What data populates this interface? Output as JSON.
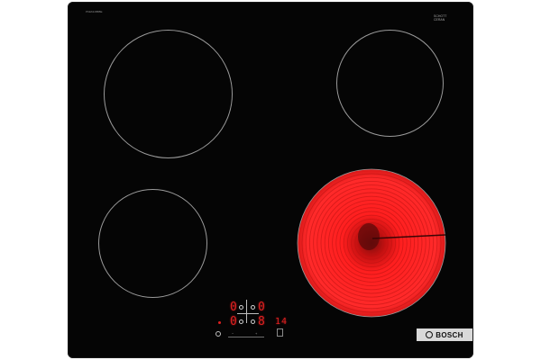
{
  "cooktop": {
    "model_label": "PKE611BB8E",
    "glass_marking_line1": "SCHOTT",
    "glass_marking_line2": "CERAN",
    "glass_marking_line3": "",
    "brand": "BOSCH",
    "colors": {
      "glass": "#050505",
      "zone_outline": "#9a9a9a",
      "hot_zone": "#ff1a1a",
      "display_red": "#e02020",
      "brand_plate": "#d9d9d9"
    }
  },
  "zones": [
    {
      "name": "front-left",
      "state": "off"
    },
    {
      "name": "rear-left",
      "state": "off"
    },
    {
      "name": "rear-right",
      "state": "off"
    },
    {
      "name": "front-right",
      "state": "on"
    }
  ],
  "display": {
    "rear_left_level": "0",
    "rear_right_level": "0",
    "front_left_level": "0",
    "front_right_level": "8",
    "timer_value": "14",
    "minus_label": "−",
    "plus_label": "+",
    "power_icon": "power-icon"
  }
}
